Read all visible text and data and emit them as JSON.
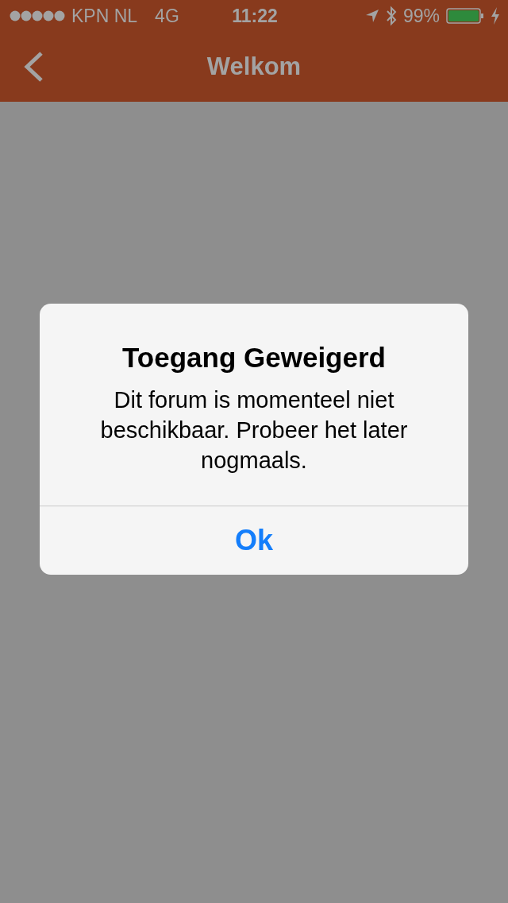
{
  "status_bar": {
    "carrier": "KPN NL",
    "network": "4G",
    "time": "11:22",
    "battery_text": "99%"
  },
  "nav_bar": {
    "title": "Welkom"
  },
  "alert": {
    "title": "Toegang Geweigerd",
    "message": "Dit forum is momenteel niet beschikbaar. Probeer het later nogmaals.",
    "buttons": [
      "Ok"
    ]
  }
}
